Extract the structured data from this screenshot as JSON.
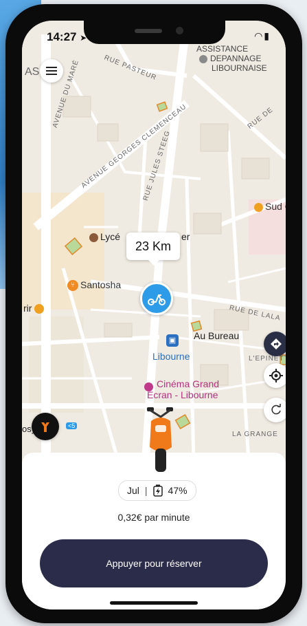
{
  "status_bar": {
    "time": "14:27"
  },
  "map": {
    "streets": {
      "avenue_du_marechal": "AVENUE DU MARÉ",
      "avenue_georges_clemenceau": "AVENUE GEORGES CLEMENCEAU",
      "rue_pasteur": "RUE PASTEUR",
      "rue_jules_steeg": "RUE JULES STEEG",
      "rue_de_lalande": "RUE DE LALA",
      "la_grange": "LA GRANGE",
      "l_epinette": "L'EPINETTE",
      "rue_de": "RUE DE"
    },
    "pois": {
      "assistance": "ASSISTANCE",
      "depannage": "DEPANNAGE",
      "libournaise": "LIBOURNAISE",
      "lycee": "Lycé",
      "lycee_end": "er",
      "santosha": "Santosha",
      "sud_ouest": "Sud O",
      "au_bureau": "Au Bureau",
      "libourne_station": "Libourne",
      "cinema_line1": "Cinéma Grand",
      "cinema_line2": "Écran - Libourne",
      "fragment_as": "AS",
      "fragment_rir": "rir",
      "fragment_tour": "osy Tour",
      "fragment_5": "<5"
    },
    "distance_tooltip": "23 Km"
  },
  "vehicle_card": {
    "name": "Jul",
    "separator": "|",
    "battery": "47%",
    "price": "0,32€ par minute",
    "reserve_button": "Appuyer pour réserver"
  },
  "colors": {
    "primary_dark": "#2a2c49",
    "pin_blue": "#2d9be8",
    "scooter_orange": "#f07a1a"
  }
}
